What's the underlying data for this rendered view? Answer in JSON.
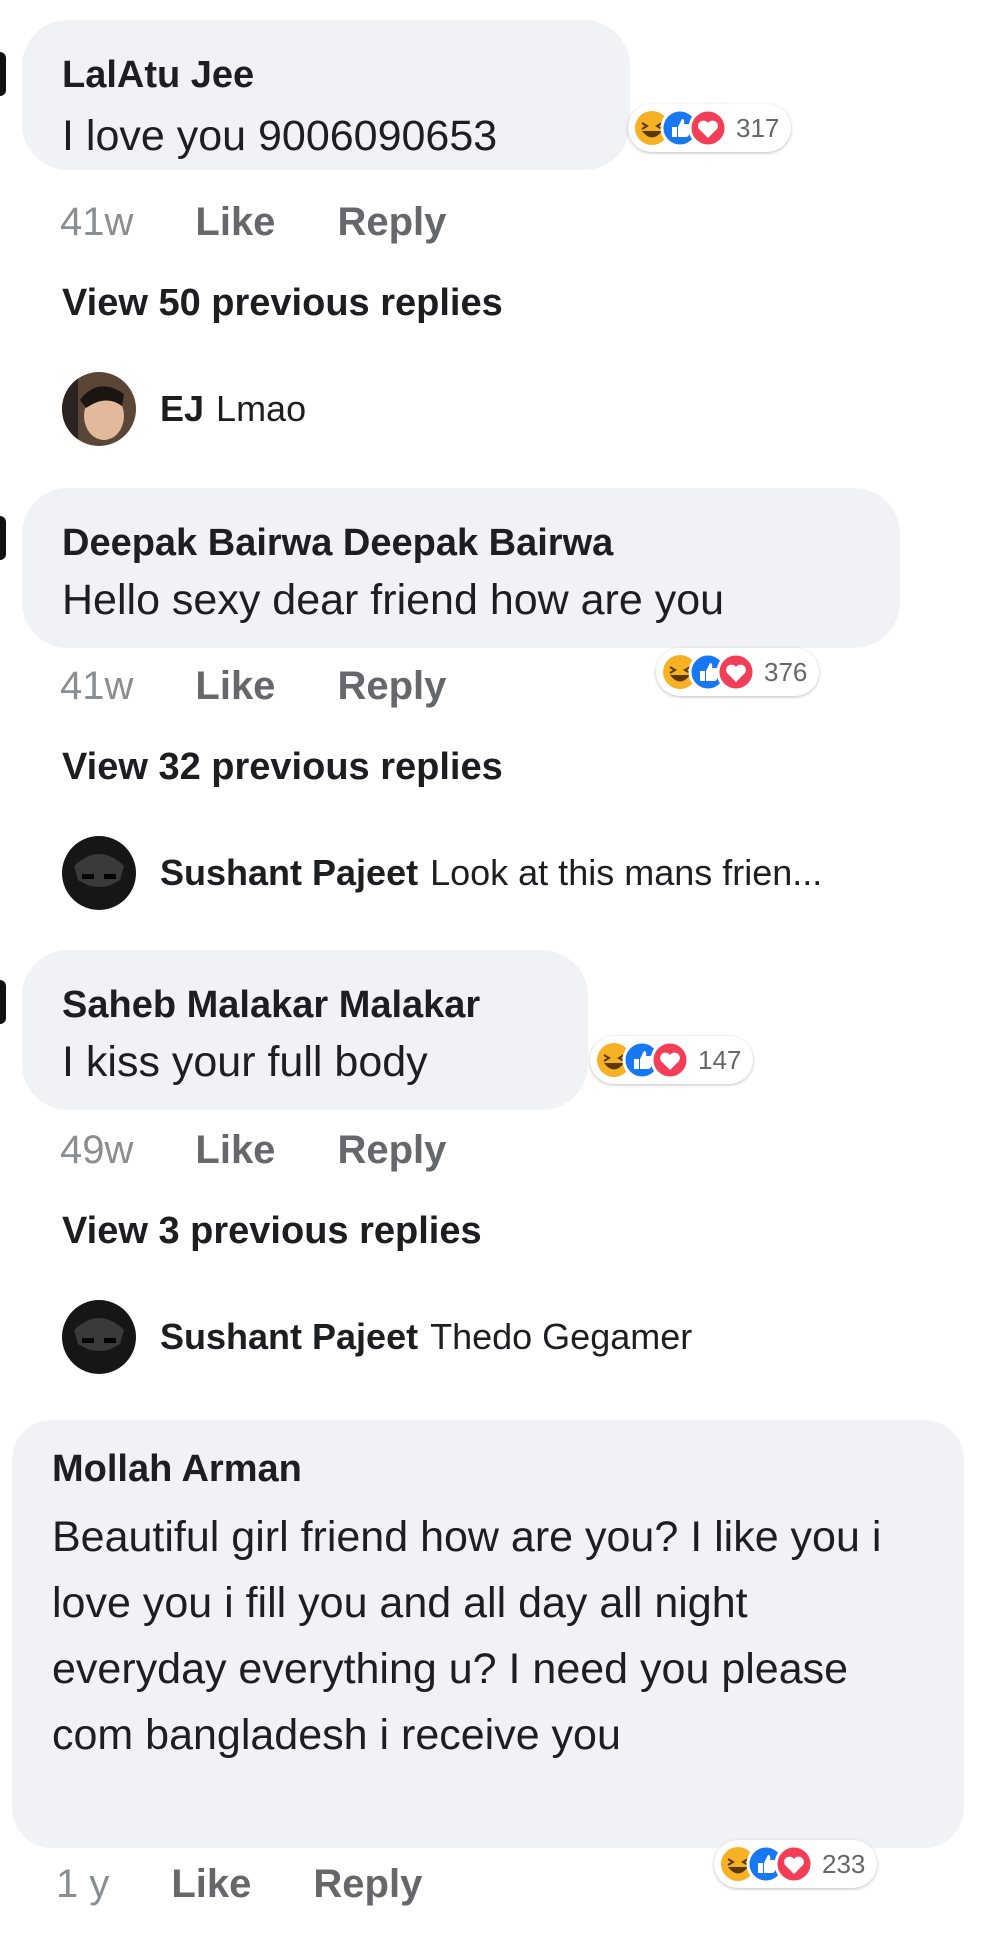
{
  "comments": [
    {
      "author": "LalAtu Jee",
      "text": "I love you 9006090653",
      "time": "41w",
      "like": "Like",
      "reply": "Reply",
      "reaction_count": "317",
      "view_more": "View 50 previous replies",
      "latest_reply": {
        "author": "EJ",
        "text": "Lmao"
      }
    },
    {
      "author": "Deepak Bairwa Deepak Bairwa",
      "text": "Hello sexy dear friend how are you",
      "time": "41w",
      "like": "Like",
      "reply": "Reply",
      "reaction_count": "376",
      "view_more": "View 32 previous replies",
      "latest_reply": {
        "author": "Sushant Pajeet",
        "text": "Look at this mans frien..."
      }
    },
    {
      "author": "Saheb Malakar Malakar",
      "text": "I kiss your full body",
      "time": "49w",
      "like": "Like",
      "reply": "Reply",
      "reaction_count": "147",
      "view_more": "View 3 previous replies",
      "latest_reply": {
        "author": "Sushant Pajeet",
        "text": "Thedo Gegamer"
      }
    },
    {
      "author": "Mollah Arman",
      "text": "Beautiful girl friend how are you? I like you i love you i fill you and all day all night everyday everything u? I need you please com bangladesh i receive you",
      "time": "1 y",
      "like": "Like",
      "reply": "Reply",
      "reaction_count": "233"
    }
  ],
  "reaction_icons": [
    "haha-icon",
    "like-icon",
    "love-icon"
  ],
  "colors": {
    "bubble": "#f0f2f5",
    "like_blue": "#1877f2",
    "love_red": "#f33e58",
    "haha_yellow": "#f7b125",
    "meta_gray": "#65676b"
  }
}
